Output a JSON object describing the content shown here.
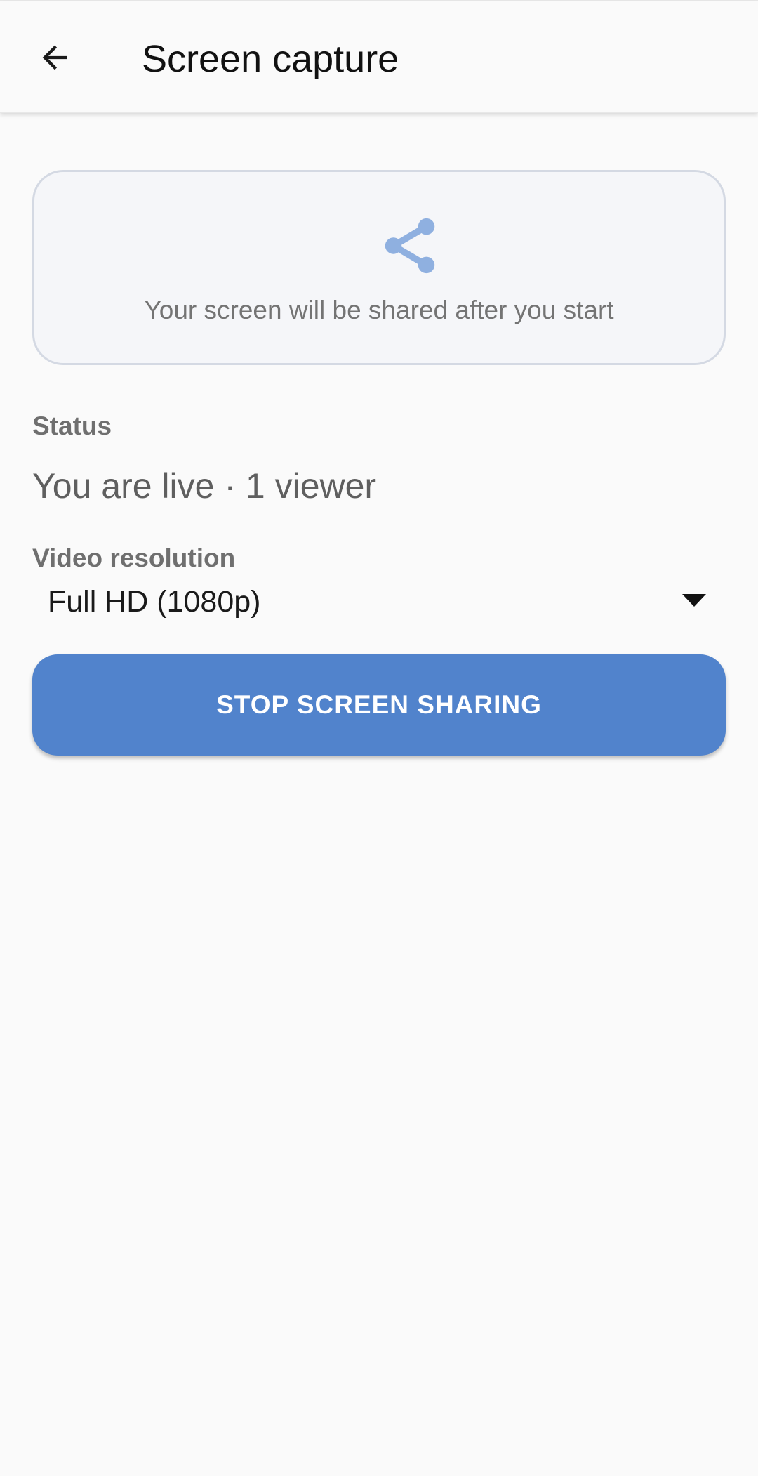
{
  "header": {
    "title": "Screen capture",
    "back_icon": "arrow-back-icon"
  },
  "preview": {
    "icon": "share-icon",
    "icon_color": "#8fb0e0",
    "message": "Your screen will be shared after you start"
  },
  "status": {
    "label": "Status",
    "value": "You are live · 1 viewer"
  },
  "resolution": {
    "label": "Video resolution",
    "selected": "Full HD (1080p)",
    "dropdown_icon": "caret-down-icon"
  },
  "actions": {
    "stop_label": "STOP SCREEN SHARING",
    "stop_color": "#5183cc"
  }
}
